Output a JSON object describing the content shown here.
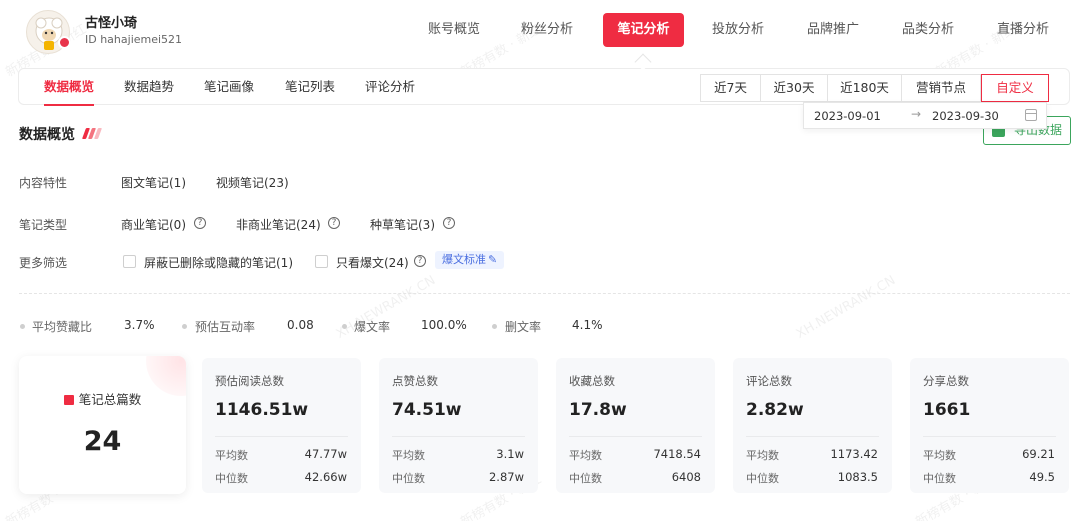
{
  "account": {
    "name": "古怪小琦",
    "id": "ID hahajiemei521"
  },
  "nav": {
    "tabs": [
      {
        "label": "账号概览",
        "active": false
      },
      {
        "label": "粉丝分析",
        "active": false
      },
      {
        "label": "笔记分析",
        "active": true
      },
      {
        "label": "投放分析",
        "active": false
      },
      {
        "label": "品牌推广",
        "active": false
      },
      {
        "label": "品类分析",
        "active": false
      },
      {
        "label": "直播分析",
        "active": false
      }
    ]
  },
  "subnav": {
    "tabs": [
      {
        "label": "数据概览",
        "active": true
      },
      {
        "label": "数据趋势",
        "active": false
      },
      {
        "label": "笔记画像",
        "active": false
      },
      {
        "label": "笔记列表",
        "active": false
      },
      {
        "label": "评论分析",
        "active": false
      }
    ],
    "ranges": [
      {
        "label": "近7天",
        "active": false
      },
      {
        "label": "近30天",
        "active": false
      },
      {
        "label": "近180天",
        "active": false
      },
      {
        "label": "营销节点",
        "active": false
      },
      {
        "label": "自定义",
        "active": true
      }
    ]
  },
  "date_range": {
    "start": "2023-09-01",
    "arrow": "→",
    "end": "2023-09-30"
  },
  "export_label": "导出数据",
  "section_title": "数据概览",
  "filters": {
    "content": {
      "label": "内容特性",
      "options": [
        "图文笔记(1)",
        "视频笔记(23)"
      ]
    },
    "type": {
      "label": "笔记类型",
      "options": [
        "商业笔记(0)",
        "非商业笔记(24)",
        "种草笔记(3)"
      ]
    },
    "more": {
      "label": "更多筛选",
      "options": [
        "屏蔽已删除或隐藏的笔记(1)",
        "只看爆文(24)"
      ],
      "tag": "爆文标准"
    }
  },
  "metrics": [
    {
      "label": "平均赞藏比",
      "value": "3.7%"
    },
    {
      "label": "预估互动率",
      "value": "0.08"
    },
    {
      "label": "爆文率",
      "value": "100.0%"
    },
    {
      "label": "删文率",
      "value": "4.1%"
    }
  ],
  "total_card": {
    "label": "笔记总篇数",
    "value": "24"
  },
  "cards": [
    {
      "title": "预估阅读总数",
      "value": "1146.51w",
      "avg_label": "平均数",
      "avg": "47.77w",
      "median_label": "中位数",
      "median": "42.66w"
    },
    {
      "title": "点赞总数",
      "value": "74.51w",
      "avg_label": "平均数",
      "avg": "3.1w",
      "median_label": "中位数",
      "median": "2.87w"
    },
    {
      "title": "收藏总数",
      "value": "17.8w",
      "avg_label": "平均数",
      "avg": "7418.54",
      "median_label": "中位数",
      "median": "6408"
    },
    {
      "title": "评论总数",
      "value": "2.82w",
      "avg_label": "平均数",
      "avg": "1173.42",
      "median_label": "中位数",
      "median": "1083.5"
    },
    {
      "title": "分享总数",
      "value": "1661",
      "avg_label": "平均数",
      "avg": "69.21",
      "median_label": "中位数",
      "median": "49.5"
    }
  ],
  "watermarks": [
    "新榜有数 · 新红",
    "XH.NEWRANK.CN"
  ],
  "colors": {
    "accent": "#ef2c42",
    "export": "#3ba55c",
    "tag": "#4a6ee0"
  }
}
